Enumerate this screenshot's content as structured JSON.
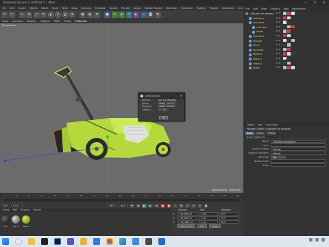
{
  "window": {
    "title": "Tondeuse (Scene 3 Untitled *) - Main",
    "controls": [
      "–",
      "❐",
      "✕"
    ]
  },
  "menubar": {
    "items": [
      "File",
      "Edit",
      "Create",
      "Modes",
      "Select",
      "Tools",
      "Mesh",
      "Snap",
      "Animate",
      "Simulate",
      "Tracker",
      "Render",
      "Sculpt",
      "Motion Tracker",
      "MoGraph",
      "Character",
      "Pipeline",
      "Plugins",
      "Substance",
      "Script",
      "Window",
      "Help"
    ],
    "highlight": "Window"
  },
  "toolbar": {
    "xyz": [
      "X",
      "Y",
      "Z"
    ]
  },
  "viewport_menu": {
    "items": [
      "View",
      "Cameras",
      "Display",
      "Options",
      "Filter",
      "Panel",
      "ProRender"
    ],
    "active": "ProRender"
  },
  "viewport": {
    "label": "Perspective",
    "grid_spacing": "Grid Spacing : 10000 cm"
  },
  "info_dialog": {
    "title": "Information",
    "rows": [
      {
        "k": "Meshes",
        "v": "aly: 11078(604)"
      },
      {
        "k": "Points",
        "v": "19605 (16277)"
      },
      {
        "k": "Polygons",
        "v": "19605 (18904)"
      },
      {
        "k": "Objects",
        "v": "27 (26)"
      }
    ],
    "ok": "OK"
  },
  "timeline": {
    "ticks": [
      "0",
      "5",
      "10",
      "15",
      "20",
      "25",
      "30",
      "35",
      "40",
      "45",
      "50",
      "55",
      "60",
      "65",
      "70",
      "75",
      "80",
      "85",
      "90"
    ]
  },
  "transport": {
    "start": "0 F",
    "current": "0 F",
    "end": "90 F",
    "end2": "90 F"
  },
  "materials": {
    "menu": [
      "Create",
      "Edit",
      "Function",
      "Texture"
    ],
    "items": [
      "Mat",
      "Mat.1",
      "Mat.2"
    ]
  },
  "coordinates": {
    "headers": [
      "Position",
      "Size",
      "Rotation"
    ],
    "rows": [
      {
        "axis": "X",
        "pos": "44.556 cm",
        "size": "0 cm",
        "rot": "H 0 °"
      },
      {
        "axis": "Y",
        "pos": "34.166 cm",
        "size": "0 cm",
        "rot": "P 0 °"
      },
      {
        "axis": "Z",
        "pos": "121.686 cm",
        "size": "0 cm",
        "rot": "B 0 °"
      }
    ],
    "mode": "Object (Rel)",
    "size_mode": "Size",
    "apply": "Apply"
  },
  "object_manager": {
    "menu": [
      "File",
      "Edit",
      "View",
      "Objects",
      "Tags",
      "Bookmarks"
    ],
    "objects": [
      {
        "name": "cultivator de grasses",
        "indent": 0,
        "color": "w"
      },
      {
        "name": "cultivator",
        "indent": 1,
        "color": "y"
      },
      {
        "name": "arrachera",
        "indent": 1,
        "color": "y"
      },
      {
        "name": "cultivator",
        "indent": 2,
        "color": "y"
      },
      {
        "name": "wheel",
        "indent": 2,
        "color": "y"
      },
      {
        "name": "Extrude.1",
        "indent": 1,
        "color": "y"
      },
      {
        "name": "Extrude",
        "indent": 1,
        "color": "y"
      },
      {
        "name": "Clone",
        "indent": 1,
        "color": "y"
      },
      {
        "name": "Extruded",
        "indent": 1,
        "color": "y"
      },
      {
        "name": "Wheel.1",
        "indent": 1,
        "color": "y"
      },
      {
        "name": "wheel.2",
        "indent": 1,
        "color": "y"
      },
      {
        "name": "wheel.3",
        "indent": 1,
        "color": "y"
      },
      {
        "name": "wheel",
        "indent": 1,
        "color": "y"
      }
    ]
  },
  "attribute_manager": {
    "menu": [
      "Mode",
      "Edit",
      "User Data"
    ],
    "title": "Polygon Object [cultivator de grasses]",
    "tabs": [
      "Basic",
      "Coord.",
      "Phong"
    ],
    "active_tab": "Basic",
    "section": "Basic Properties",
    "props": [
      {
        "label": "Name",
        "value": "cultivator de grasses"
      },
      {
        "label": "Layer",
        "value": ""
      },
      {
        "label": "Visible in Editor",
        "value": "Default"
      },
      {
        "label": "Visible in Renderer",
        "value": "Default"
      },
      {
        "label": "Use Color",
        "value": "Off",
        "short": true
      },
      {
        "label": "Display Color",
        "value": ""
      },
      {
        "label": "X-Ray",
        "value": ""
      }
    ]
  },
  "taskbar": {
    "apps": [
      "start",
      "search",
      "files",
      "x",
      "c4d",
      "teams",
      "folder",
      "vscode",
      "chrome",
      "edge",
      "photos",
      "store",
      "mail"
    ]
  }
}
